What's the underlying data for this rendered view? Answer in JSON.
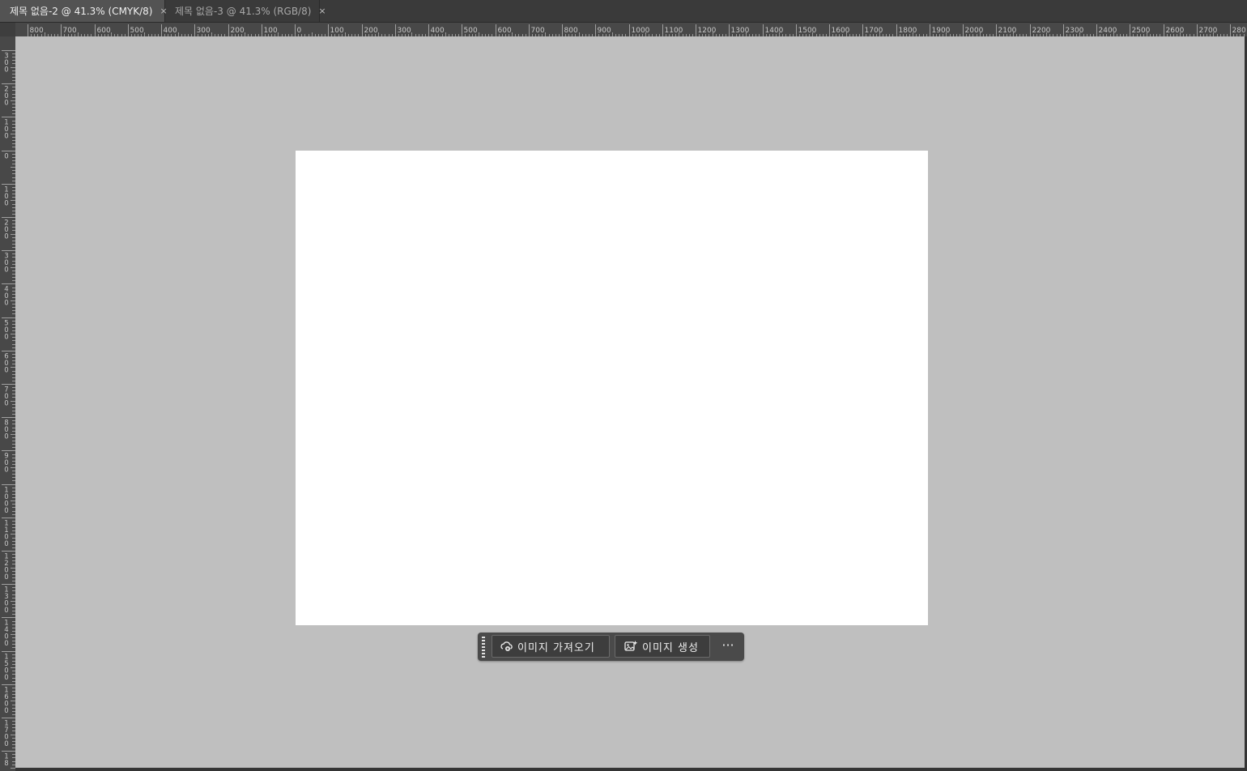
{
  "tabs": [
    {
      "title": "제목 없음-2 @ 41.3% (CMYK/8)",
      "close": "×"
    },
    {
      "title": "제목 없음-3 @ 41.3% (RGB/8)",
      "close": "×"
    }
  ],
  "rulers": {
    "horizontal_labels": [
      "800",
      "700",
      "600",
      "500",
      "400",
      "300",
      "200",
      "100",
      "0",
      "100",
      "200",
      "300",
      "400",
      "500",
      "600",
      "700",
      "800",
      "900",
      "1000",
      "1100",
      "1200",
      "1300",
      "1400",
      "1500",
      "1600",
      "1700",
      "1800",
      "1900",
      "2000",
      "2100",
      "2200",
      "2300",
      "2400",
      "2500",
      "2600",
      "2700",
      "280"
    ],
    "vertical_labels": [
      "300",
      "200",
      "100",
      "0",
      "100",
      "200",
      "300",
      "400",
      "500",
      "600",
      "700",
      "800",
      "900",
      "1000",
      "1100",
      "1200",
      "1300",
      "1400",
      "1500",
      "1600",
      "1700",
      "18"
    ]
  },
  "contextual_taskbar": {
    "import_image_label": "이미지 가져오기",
    "generate_image_label": "이미지 생성",
    "more_label": "···"
  },
  "colors": {
    "pasteboard": "#bfbfbf",
    "document": "#ffffff",
    "ui_dark": "#3a3a3a"
  }
}
